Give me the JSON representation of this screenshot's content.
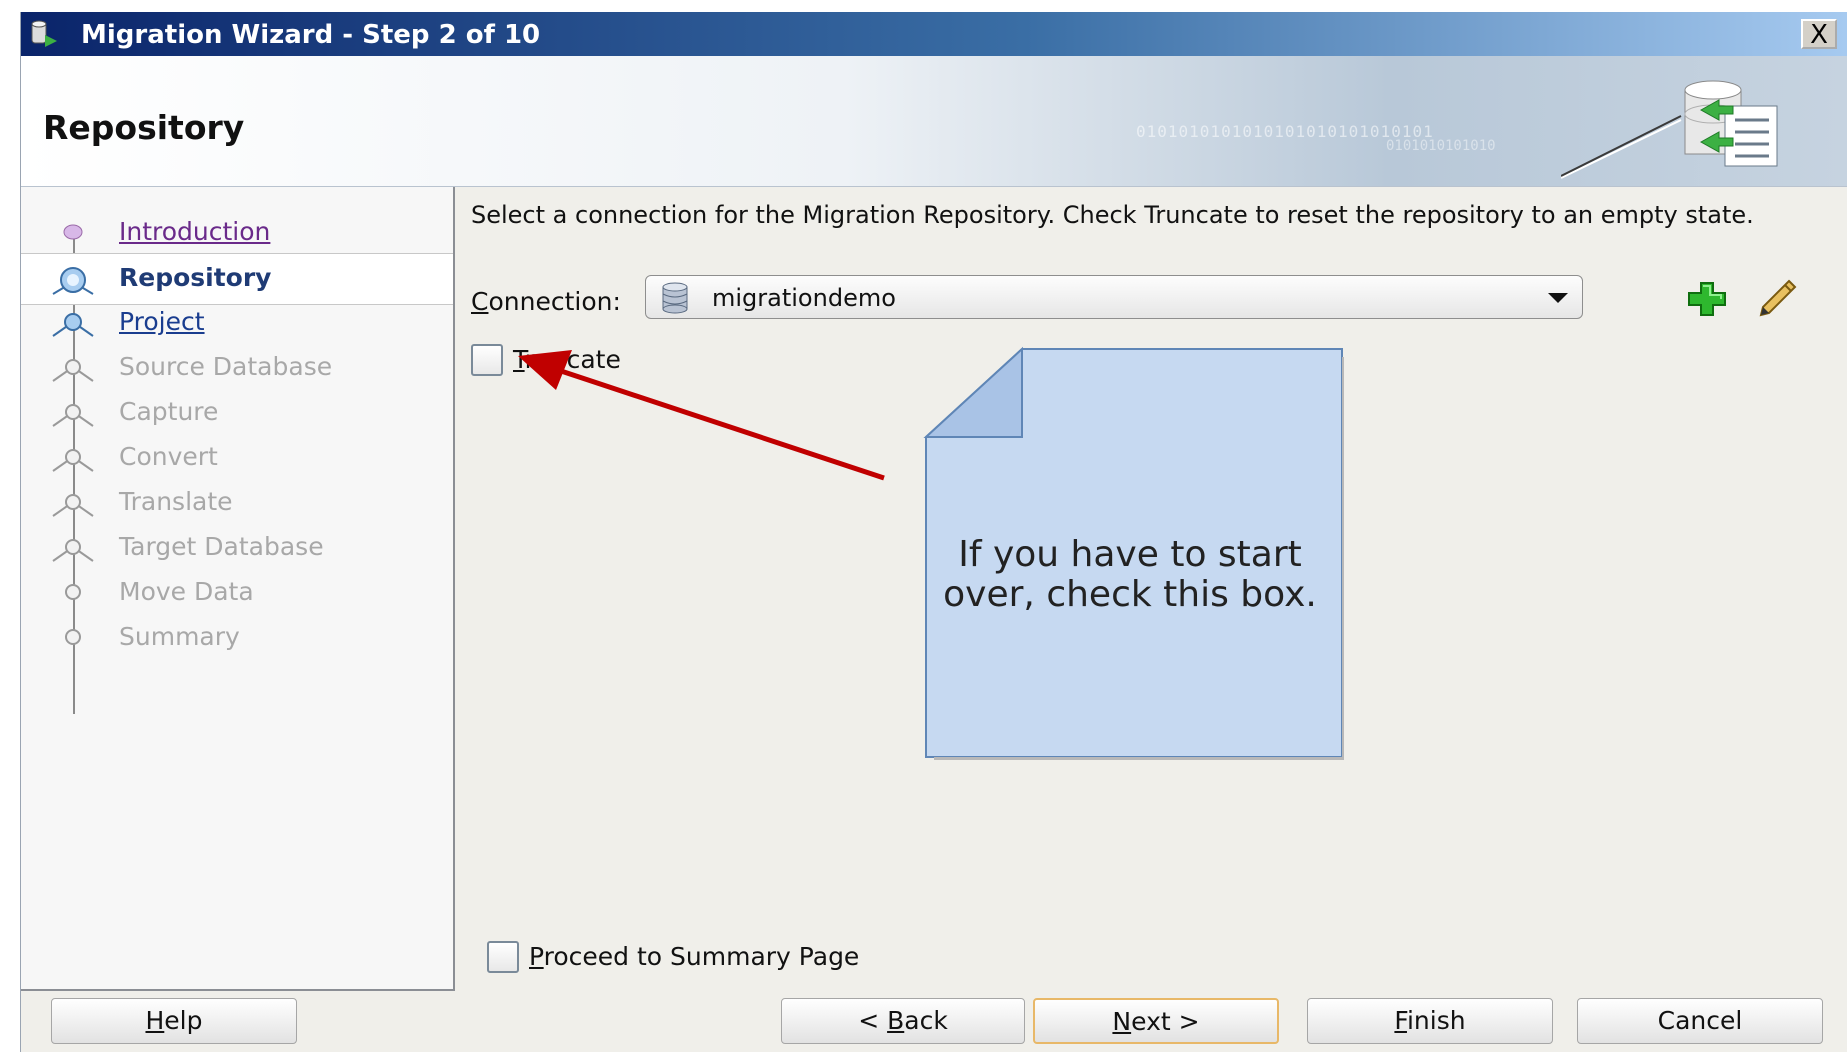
{
  "window": {
    "title": "Migration Wizard - Step 2 of 10",
    "close_label": "X"
  },
  "banner": {
    "title": "Repository",
    "binary_text": "0101010101010101010101010101",
    "binary_text2": "0101010101010"
  },
  "nav": {
    "steps": [
      {
        "label": "Introduction",
        "state": "visited"
      },
      {
        "label": "Repository",
        "state": "current"
      },
      {
        "label": "Project",
        "state": "next"
      },
      {
        "label": "Source Database",
        "state": "disabled"
      },
      {
        "label": "Capture",
        "state": "disabled"
      },
      {
        "label": "Convert",
        "state": "disabled"
      },
      {
        "label": "Translate",
        "state": "disabled"
      },
      {
        "label": "Target Database",
        "state": "disabled"
      },
      {
        "label": "Move Data",
        "state": "disabled"
      },
      {
        "label": "Summary",
        "state": "disabled"
      }
    ]
  },
  "content": {
    "instructions": "Select a connection for the Migration Repository.  Check Truncate to reset the repository to an empty state.",
    "connection_label_mnemonic": "C",
    "connection_label_rest": "onnection:",
    "connection_value": "migrationdemo",
    "truncate_mnemonic": "T",
    "truncate_rest": "runcate",
    "truncate_checked": false,
    "proceed_mnemonic": "P",
    "proceed_rest": "roceed to Summary Page",
    "proceed_checked": false
  },
  "callout": {
    "text": "If you have to start over, check this box.",
    "fill_color": "#c6d9f1",
    "arrow_color": "#c00000"
  },
  "buttons": {
    "help_mnemonic": "H",
    "help_rest": "elp",
    "back_prefix": "< ",
    "back_mnemonic": "B",
    "back_rest": "ack",
    "next_mnemonic": "N",
    "next_rest": "ext >",
    "finish_mnemonic": "F",
    "finish_rest": "inish",
    "cancel_label": "Cancel"
  },
  "icons": {
    "app": "migration-wizard-icon",
    "banner": "database-migration-graphic",
    "connection": "database-icon",
    "add": "green-plus-icon",
    "edit": "pencil-icon"
  }
}
